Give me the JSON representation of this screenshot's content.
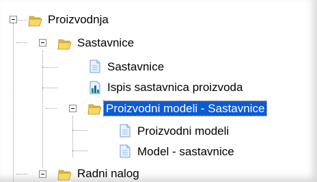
{
  "tree": {
    "items": [
      {
        "label": "Proizvodnja",
        "icon": "folder-open-icon",
        "expanded": true,
        "selected": false
      },
      {
        "label": "Sastavnice",
        "icon": "folder-open-icon",
        "expanded": true,
        "selected": false
      },
      {
        "label": "Sastavnice",
        "icon": "document-icon",
        "selected": false
      },
      {
        "label": "Ispis sastavnica proizvoda",
        "icon": "report-chart-icon",
        "selected": false
      },
      {
        "label": "Proizvodni modeli - Sastavnice",
        "icon": "folder-open-icon",
        "expanded": true,
        "selected": true
      },
      {
        "label": "Proizvodni modeli",
        "icon": "document-icon",
        "selected": false
      },
      {
        "label": "Model - sastavnice",
        "icon": "document-icon",
        "selected": false
      },
      {
        "label": "Radni nalog",
        "icon": "folder-open-icon",
        "expanded": true,
        "selected": false
      }
    ]
  },
  "colors": {
    "selection": "#0a5bd6",
    "folder": "#f2cf4e",
    "document": "#6f9fd6"
  }
}
